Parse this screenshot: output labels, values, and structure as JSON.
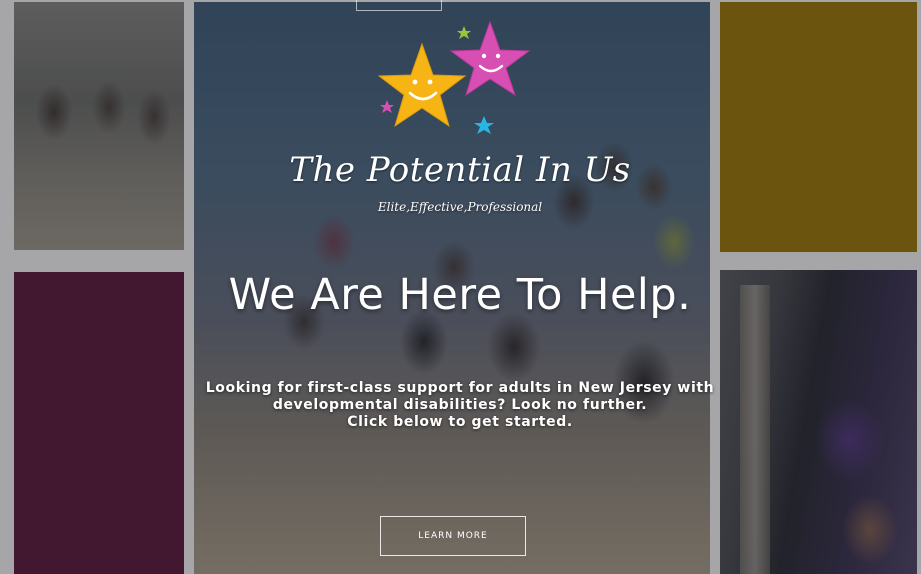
{
  "brand": {
    "name": "The Potential In Us",
    "tagline": "Elite,Effective,Professional"
  },
  "hero": {
    "headline": "We Are Here To Help.",
    "subtext": [
      "Looking for first-class support for adults  in New Jersey with",
      "developmental disabilities? Look no further.",
      "Click below to get started."
    ],
    "cta_label": "LEARN MORE"
  },
  "icons": {
    "logo": "two-smiling-stars-logo"
  },
  "colors": {
    "tile_magenta": "#5e1a3c",
    "tile_gold": "#a17c05",
    "star_yellow": "#f7b515",
    "star_pink": "#d84fb4",
    "star_cyan": "#29b6e6"
  }
}
